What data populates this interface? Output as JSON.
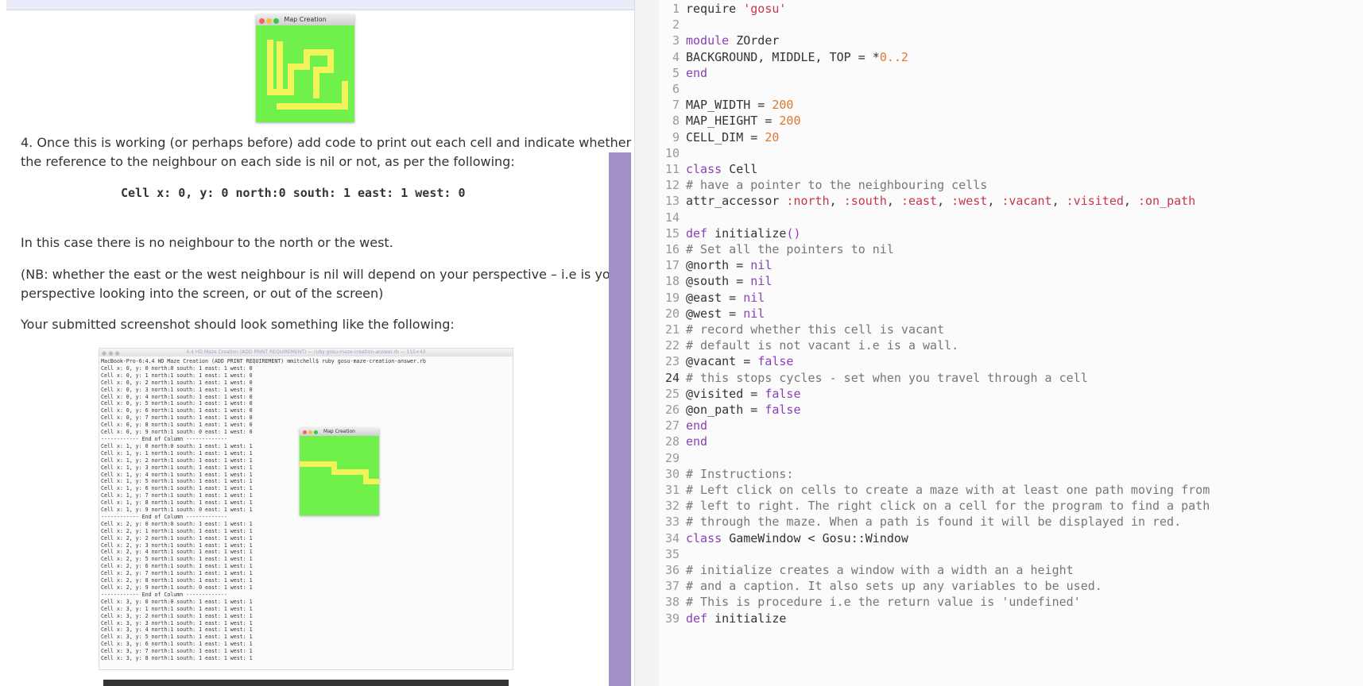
{
  "document": {
    "map_window_title": "Map Creation",
    "instruction_heading": "4.  Once this is working (or perhaps before) add code to print out each cell and indicate whether",
    "instruction_heading_line2": "the reference to the neighbour on each side is nil or not, as per the following:",
    "sample_line": "Cell x: 0, y: 0 north:0 south: 1 east: 1 west: 0",
    "para_no_neighbour": "In this case there is no neighbour to the north or the west.",
    "para_nb_line1": "(NB: whether the east or the west neighbour is nil will depend on your perspective – i.e is your",
    "para_nb_line2": "perspective looking into the screen, or out of the screen)",
    "para_screenshot": "Your submitted screenshot should look something like the following:",
    "terminal_title": "4.4 HD Maze Creation (ADD PRINT REQUIREMENT) — ruby gosu-maze-creation-answer.rb — 115×43",
    "terminal_window_title": "Map Creation",
    "terminal_lines": [
      "MacBook-Pro-6:4.4 HD Maze Creation (ADD PRINT REQUIREMENT) mmitchell$ ruby gosu-maze-creation-answer.rb",
      "Cell x: 0, y: 0 north:0 south: 1 east: 1 west: 0",
      "Cell x: 0, y: 1 north:1 south: 1 east: 1 west: 0",
      "Cell x: 0, y: 2 north:1 south: 1 east: 1 west: 0",
      "Cell x: 0, y: 3 north:1 south: 1 east: 1 west: 0",
      "Cell x: 0, y: 4 north:1 south: 1 east: 1 west: 0",
      "Cell x: 0, y: 5 north:1 south: 1 east: 1 west: 0",
      "Cell x: 0, y: 6 north:1 south: 1 east: 1 west: 0",
      "Cell x: 0, y: 7 north:1 south: 1 east: 1 west: 0",
      "Cell x: 0, y: 8 north:1 south: 1 east: 1 west: 0",
      "Cell x: 0, y: 9 north:1 south: 0 east: 1 west: 0",
      "------------ End of Column -------------",
      "Cell x: 1, y: 0 north:0 south: 1 east: 1 west: 1",
      "Cell x: 1, y: 1 north:1 south: 1 east: 1 west: 1",
      "Cell x: 1, y: 2 north:1 south: 1 east: 1 west: 1",
      "Cell x: 1, y: 3 north:1 south: 1 east: 1 west: 1",
      "Cell x: 1, y: 4 north:1 south: 1 east: 1 west: 1",
      "Cell x: 1, y: 5 north:1 south: 1 east: 1 west: 1",
      "Cell x: 1, y: 6 north:1 south: 1 east: 1 west: 1",
      "Cell x: 1, y: 7 north:1 south: 1 east: 1 west: 1",
      "Cell x: 1, y: 8 north:1 south: 1 east: 1 west: 1",
      "Cell x: 1, y: 9 north:1 south: 0 east: 1 west: 1",
      "------------ End of Column -------------",
      "Cell x: 2, y: 0 north:0 south: 1 east: 1 west: 1",
      "Cell x: 2, y: 1 north:1 south: 1 east: 1 west: 1",
      "Cell x: 2, y: 2 north:1 south: 1 east: 1 west: 1",
      "Cell x: 2, y: 3 north:1 south: 1 east: 1 west: 1",
      "Cell x: 2, y: 4 north:1 south: 1 east: 1 west: 1",
      "Cell x: 2, y: 5 north:1 south: 1 east: 1 west: 1",
      "Cell x: 2, y: 6 north:1 south: 1 east: 1 west: 1",
      "Cell x: 2, y: 7 north:1 south: 1 east: 1 west: 1",
      "Cell x: 2, y: 8 north:1 south: 1 east: 1 west: 1",
      "Cell x: 2, y: 9 north:1 south: 0 east: 1 west: 1",
      "------------ End of Column -------------",
      "Cell x: 3, y: 0 north:0 south: 1 east: 1 west: 1",
      "Cell x: 3, y: 1 north:1 south: 1 east: 1 west: 1",
      "Cell x: 3, y: 2 north:1 south: 1 east: 1 west: 1",
      "Cell x: 3, y: 3 north:1 south: 1 east: 1 west: 1",
      "Cell x: 3, y: 4 north:1 south: 1 east: 1 west: 1",
      "Cell x: 3, y: 5 north:1 south: 1 east: 1 west: 1",
      "Cell x: 3, y: 6 north:1 south: 1 east: 1 west: 1",
      "Cell x: 3, y: 7 north:1 south: 1 east: 1 west: 1",
      "Cell x: 3, y: 8 north:1 south: 1 east: 1 west: 1"
    ]
  },
  "code": {
    "lines": [
      [
        {
          "t": "require ",
          "c": ""
        },
        {
          "t": "'gosu'",
          "c": "str"
        }
      ],
      [],
      [
        {
          "t": "module ",
          "c": "kw"
        },
        {
          "t": "ZOrder",
          "c": ""
        }
      ],
      [
        {
          "t": "BACKGROUND, MIDDLE, TOP = *",
          "c": ""
        },
        {
          "t": "0..2",
          "c": "num"
        }
      ],
      [
        {
          "t": "end",
          "c": "kw"
        }
      ],
      [],
      [
        {
          "t": "MAP_WIDTH = ",
          "c": ""
        },
        {
          "t": "200",
          "c": "num"
        }
      ],
      [
        {
          "t": "MAP_HEIGHT = ",
          "c": ""
        },
        {
          "t": "200",
          "c": "num"
        }
      ],
      [
        {
          "t": "CELL_DIM = ",
          "c": ""
        },
        {
          "t": "20",
          "c": "num"
        }
      ],
      [],
      [
        {
          "t": "class ",
          "c": "kw"
        },
        {
          "t": "Cell",
          "c": ""
        }
      ],
      [
        {
          "t": "# have a pointer to the neighbouring cells",
          "c": "cm"
        }
      ],
      [
        {
          "t": "attr_accessor ",
          "c": ""
        },
        {
          "t": ":north",
          "c": "sym"
        },
        {
          "t": ", ",
          "c": ""
        },
        {
          "t": ":south",
          "c": "sym"
        },
        {
          "t": ", ",
          "c": ""
        },
        {
          "t": ":east",
          "c": "sym"
        },
        {
          "t": ", ",
          "c": ""
        },
        {
          "t": ":west",
          "c": "sym"
        },
        {
          "t": ", ",
          "c": ""
        },
        {
          "t": ":vacant",
          "c": "sym"
        },
        {
          "t": ", ",
          "c": ""
        },
        {
          "t": ":visited",
          "c": "sym"
        },
        {
          "t": ", ",
          "c": ""
        },
        {
          "t": ":on_path",
          "c": "sym"
        }
      ],
      [],
      [
        {
          "t": "def ",
          "c": "kw"
        },
        {
          "t": "initialize",
          "c": ""
        },
        {
          "t": "()",
          "c": "kw"
        }
      ],
      [
        {
          "t": "# Set all the pointers to nil",
          "c": "cm"
        }
      ],
      [
        {
          "t": "@north = ",
          "c": ""
        },
        {
          "t": "nil",
          "c": "kw"
        }
      ],
      [
        {
          "t": "@south = ",
          "c": ""
        },
        {
          "t": "nil",
          "c": "kw"
        }
      ],
      [
        {
          "t": "@east = ",
          "c": ""
        },
        {
          "t": "nil",
          "c": "kw"
        }
      ],
      [
        {
          "t": "@west = ",
          "c": ""
        },
        {
          "t": "nil",
          "c": "kw"
        }
      ],
      [
        {
          "t": "# record whether this cell is vacant",
          "c": "cm"
        }
      ],
      [
        {
          "t": "# default is not vacant i.e is a wall.",
          "c": "cm"
        }
      ],
      [
        {
          "t": "@vacant = ",
          "c": ""
        },
        {
          "t": "false",
          "c": "kw"
        }
      ],
      [
        {
          "t": "# this stops cycles - set when you travel through a cell",
          "c": "cm"
        }
      ],
      [
        {
          "t": "@visited = ",
          "c": ""
        },
        {
          "t": "false",
          "c": "kw"
        }
      ],
      [
        {
          "t": "@on_path = ",
          "c": ""
        },
        {
          "t": "false",
          "c": "kw"
        }
      ],
      [
        {
          "t": "end",
          "c": "kw"
        }
      ],
      [
        {
          "t": "end",
          "c": "kw"
        }
      ],
      [],
      [
        {
          "t": "# Instructions:",
          "c": "cm"
        }
      ],
      [
        {
          "t": "# Left click on cells to create a maze with at least one path moving from",
          "c": "cm"
        }
      ],
      [
        {
          "t": "# left to right. The right click on a cell for the program to find a path",
          "c": "cm"
        }
      ],
      [
        {
          "t": "# through the maze. When a path is found it will be displayed in red.",
          "c": "cm"
        }
      ],
      [
        {
          "t": "class ",
          "c": "kw"
        },
        {
          "t": "GameWindow < Gosu::Window",
          "c": ""
        }
      ],
      [],
      [
        {
          "t": "# initialize creates a window with a width an a height",
          "c": "cm"
        }
      ],
      [
        {
          "t": "# and a caption. It also sets up any variables to be used.",
          "c": "cm"
        }
      ],
      [
        {
          "t": "# This is procedure i.e the return value is 'undefined'",
          "c": "cm"
        }
      ],
      [
        {
          "t": "def ",
          "c": "kw"
        },
        {
          "t": "initialize",
          "c": ""
        }
      ]
    ],
    "line_numbers": [
      "1",
      "2",
      "3",
      "4",
      "5",
      "6",
      "7",
      "8",
      "9",
      "10",
      "11",
      "12",
      "13",
      "14",
      "15",
      "16",
      "17",
      "18",
      "19",
      "20",
      "21",
      "22",
      "23",
      "24",
      "25",
      "26",
      "27",
      "28",
      "29",
      "30",
      "31",
      "32",
      "33",
      "34",
      "35",
      "36",
      "37",
      "38",
      "39"
    ],
    "active_line": "24"
  },
  "colors": {
    "maze_green": "#6ff04b",
    "maze_yellow": "#f2f25a",
    "scrollbar": "#a28fc7",
    "keyword": "#8a40b5",
    "string": "#c8364e",
    "number": "#e0772c"
  }
}
